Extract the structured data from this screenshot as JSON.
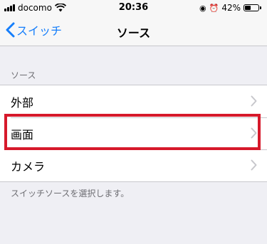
{
  "status_bar": {
    "carrier": "docomo",
    "time": "20:36",
    "battery": "42%",
    "battery_level": 0.42
  },
  "nav": {
    "back_label": "スイッチ",
    "title": "ソース"
  },
  "section": {
    "header": "ソース",
    "items": [
      {
        "label": "外部"
      },
      {
        "label": "画面"
      },
      {
        "label": "カメラ"
      }
    ],
    "footer": "スイッチソースを選択します。"
  },
  "colors": {
    "accent": "#157efb",
    "highlight": "#d6192b"
  }
}
